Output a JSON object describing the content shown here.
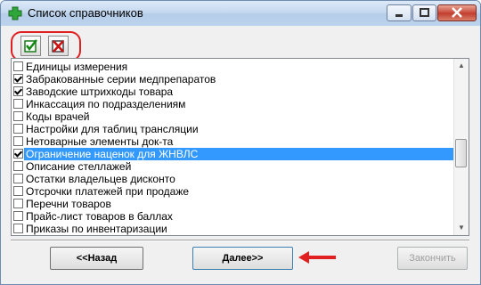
{
  "window": {
    "title": "Список справочников"
  },
  "icons": {
    "app": "green-cross-icon",
    "check_all": "check-all-icon",
    "uncheck_all": "uncheck-all-icon",
    "arrow": "arrow-left-icon"
  },
  "colors": {
    "selection": "#3399ff",
    "annotation": "#e02020"
  },
  "list": {
    "items": [
      {
        "label": "Единицы измерения",
        "checked": false,
        "selected": false
      },
      {
        "label": "Забракованные серии медпрепаратов",
        "checked": true,
        "selected": false
      },
      {
        "label": "Заводские штрихкоды товара",
        "checked": true,
        "selected": false
      },
      {
        "label": "Инкассация по подразделениям",
        "checked": false,
        "selected": false
      },
      {
        "label": "Коды врачей",
        "checked": false,
        "selected": false
      },
      {
        "label": "Настройки для таблиц трансляции",
        "checked": false,
        "selected": false
      },
      {
        "label": "Нетоварные элементы док-та",
        "checked": false,
        "selected": false
      },
      {
        "label": "Ограничение наценок для ЖНВЛС",
        "checked": true,
        "selected": true
      },
      {
        "label": "Описание стеллажей",
        "checked": false,
        "selected": false
      },
      {
        "label": "Остатки владельцев дисконто",
        "checked": false,
        "selected": false
      },
      {
        "label": "Отсрочки платежей при продаже",
        "checked": false,
        "selected": false
      },
      {
        "label": "Перечни товаров",
        "checked": false,
        "selected": false
      },
      {
        "label": "Прайс-лист товаров в баллах",
        "checked": false,
        "selected": false
      },
      {
        "label": "Приказы по инвентаризации",
        "checked": false,
        "selected": false
      }
    ]
  },
  "buttons": {
    "back": "<<Назад",
    "next": "Далее>>",
    "finish": "Закончить"
  }
}
